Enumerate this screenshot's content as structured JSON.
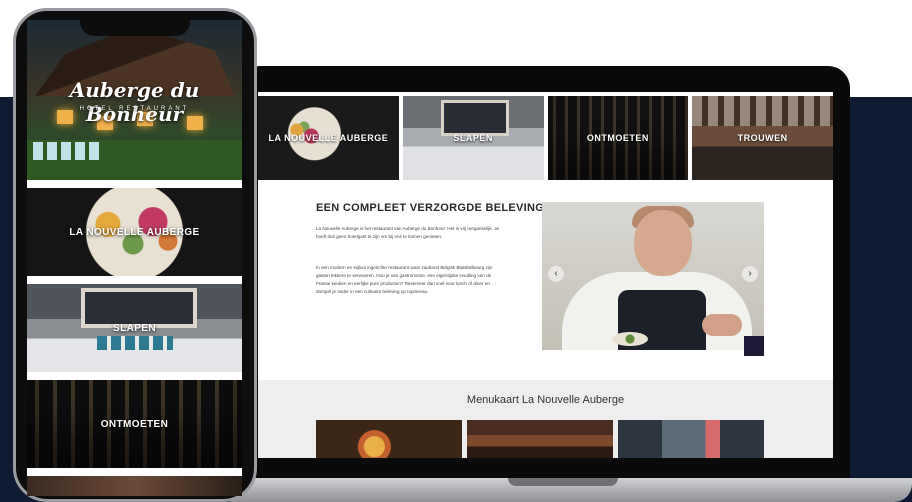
{
  "laptop": {
    "tiles": [
      {
        "label": "LA NOUVELLE AUBERGE"
      },
      {
        "label": "SLAPEN"
      },
      {
        "label": "ONTMOETEN"
      },
      {
        "label": "TROUWEN"
      }
    ],
    "intro": {
      "title": "EEN COMPLEET VERZORGDE BELEVING",
      "p1": "La Nouvelle Auberge is het restaurant van Auberge du Bonheur. Het is vrij toegankelijk. Je hoeft dus geen hotelgast te zijn om bij ons te komen genieten.",
      "p2": "In een modern en stijlvol ingerichte restaurant waar zuidrand Belgisk Blaisbelbeurg zijn gasten lekkere te verwoeren. Hou je van gastronomie, een eigentijdse invulling van de Franse keuken en eerlijke pure producten? Reserveer dan snel voor lunch of diner en dompel je onder in een culinaire beleving op topniveau."
    },
    "carousel": {
      "prev": "‹",
      "next": "›"
    },
    "menu": {
      "title": "Menukaart La Nouvelle Auberge"
    }
  },
  "phone": {
    "logo_script": "Auberge du Bonheur",
    "logo_sub": "HOTEL  RESTAURANT",
    "sections": [
      {
        "label": "LA NOUVELLE AUBERGE"
      },
      {
        "label": "SLAPEN"
      },
      {
        "label": "ONTMOETEN"
      }
    ]
  },
  "colors": {
    "navy_band": "#0e1b33",
    "device_black": "#0a0a0b",
    "menu_band": "#eeeeee"
  }
}
